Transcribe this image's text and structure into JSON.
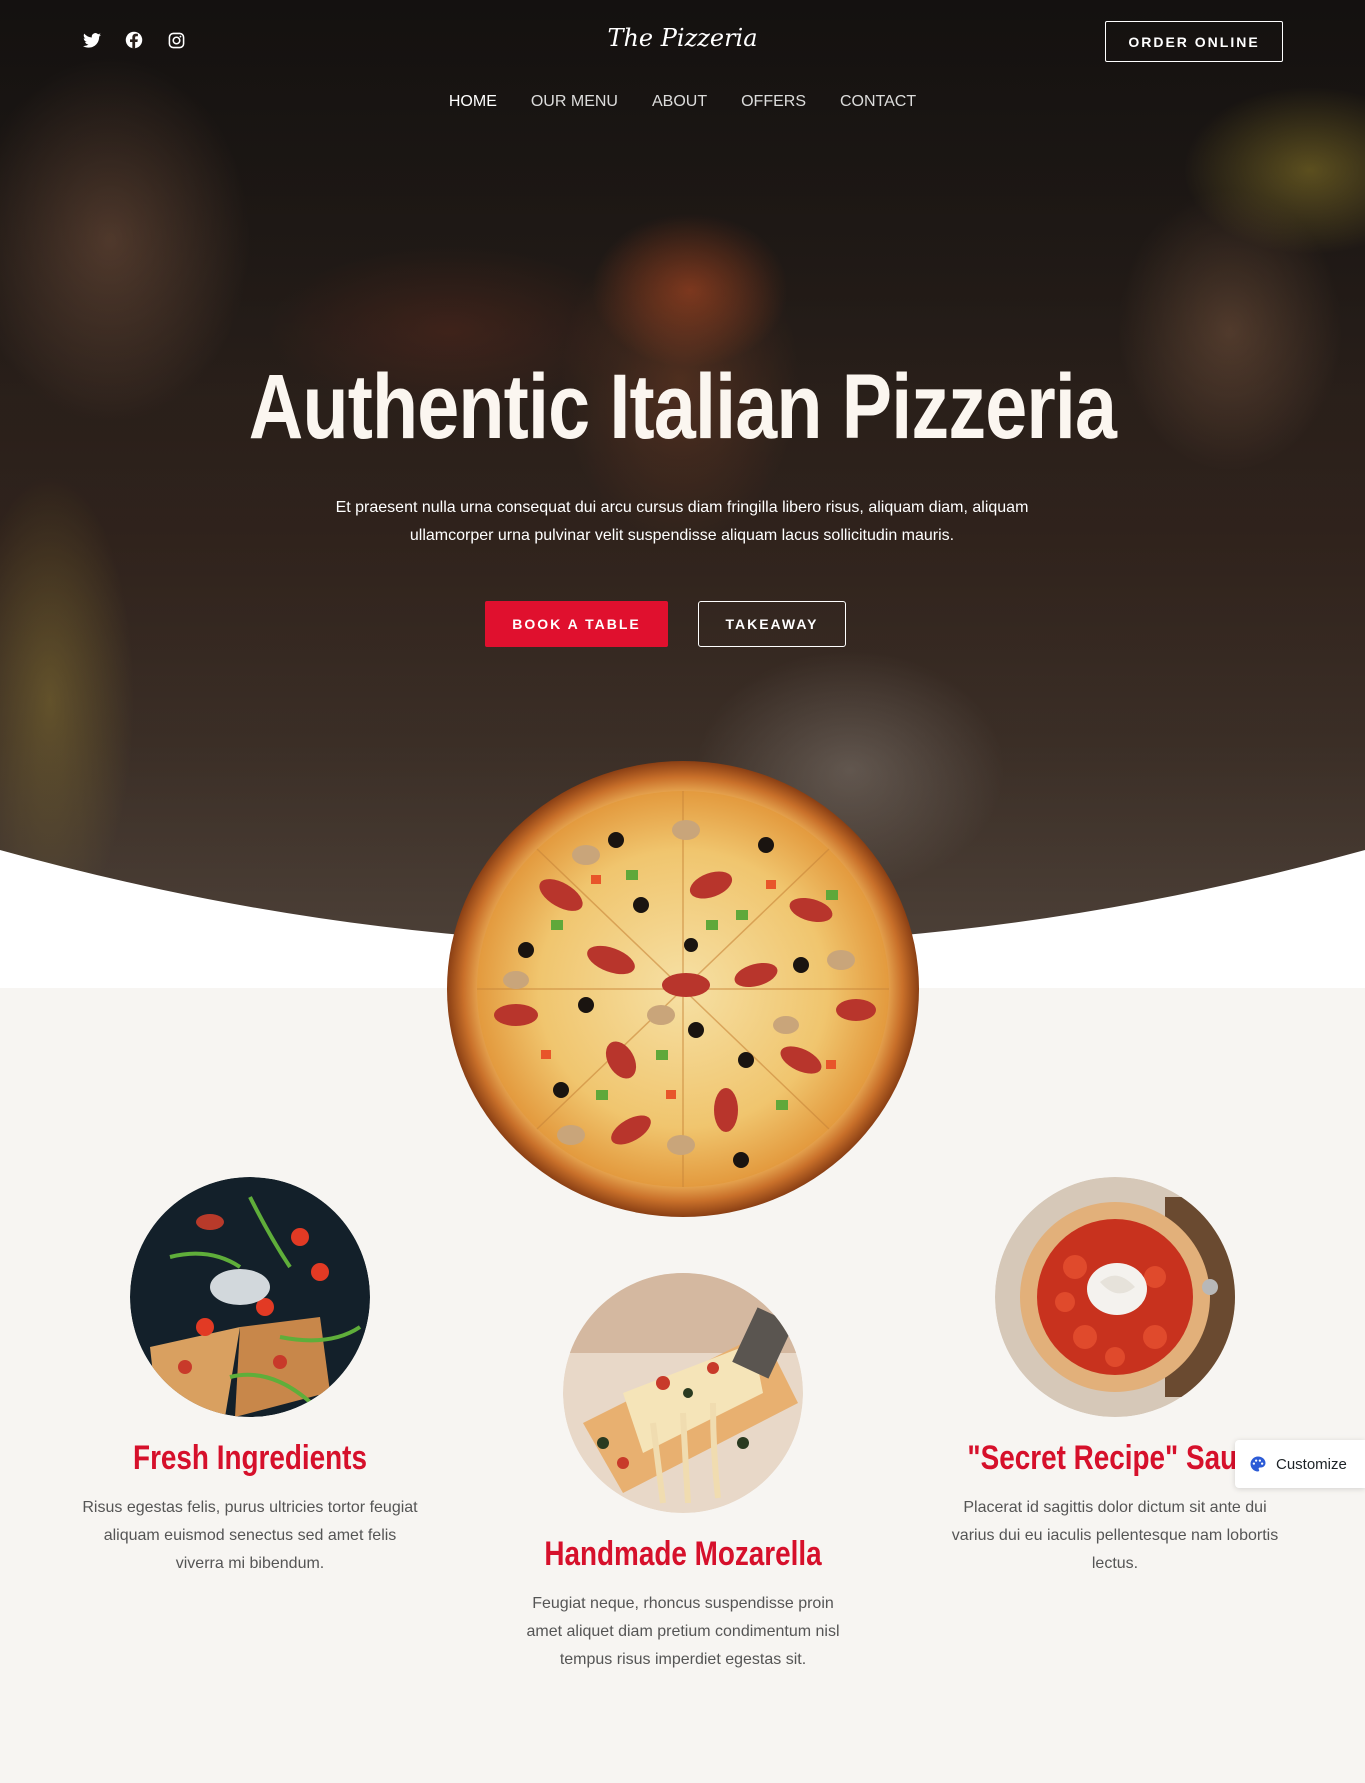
{
  "header": {
    "logo": "The Pizzeria",
    "order_button": "ORDER ONLINE",
    "social": [
      "twitter-icon",
      "facebook-icon",
      "instagram-icon"
    ]
  },
  "nav": {
    "items": [
      "HOME",
      "OUR MENU",
      "ABOUT",
      "OFFERS",
      "CONTACT"
    ],
    "active": "HOME"
  },
  "hero": {
    "title": "Authentic Italian Pizzeria",
    "subtitle": "Et praesent nulla urna consequat dui arcu cursus diam fringilla libero risus, aliquam diam, aliquam ullamcorper urna pulvinar velit suspendisse aliquam lacus sollicitudin mauris.",
    "book_button": "BOOK A TABLE",
    "takeaway_button": "TAKEAWAY"
  },
  "features": [
    {
      "title": "Fresh Ingredients",
      "text": "Risus egestas felis, purus ultricies tortor feugiat aliquam euismod senectus sed amet felis viverra mi bibendum."
    },
    {
      "title": "Handmade Mozarella",
      "text": "Feugiat neque, rhoncus suspendisse proin amet aliquet diam pretium condimentum nisl tempus risus imperdiet egestas sit."
    },
    {
      "title": "\"Secret Recipe\" Sauce",
      "text": "Placerat id sagittis dolor dictum sit ante dui varius dui eu iaculis pellentesque nam lobortis lectus."
    }
  ],
  "customize": {
    "label": "Customize"
  },
  "colors": {
    "accent": "#e0102e",
    "feature_title": "#d6102b",
    "section_bg": "#f7f5f2"
  }
}
